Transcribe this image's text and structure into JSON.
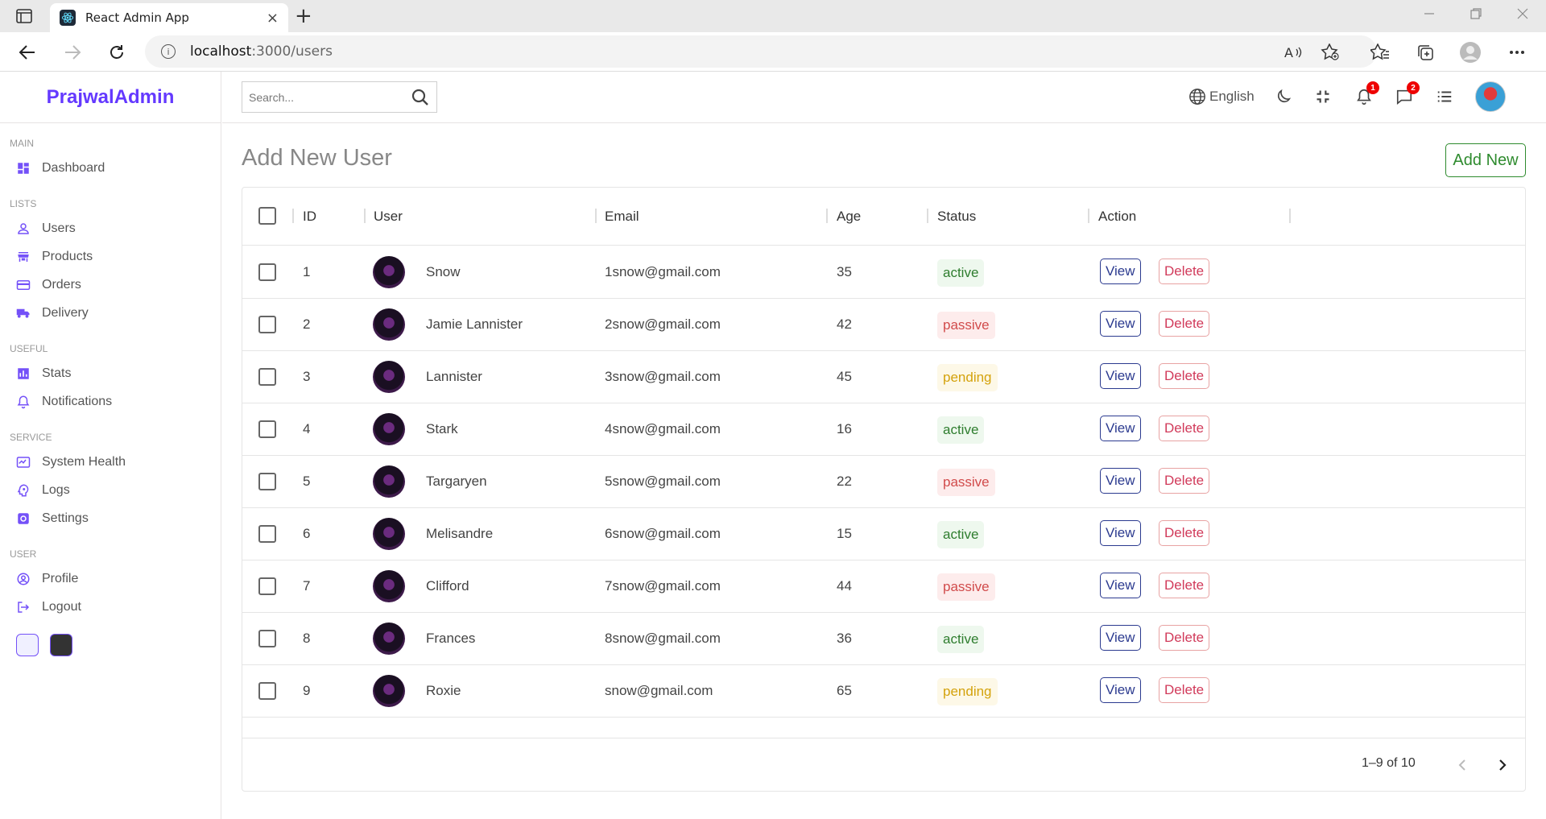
{
  "browser": {
    "tab_title": "React Admin App",
    "tab_close": "×",
    "new_tab": "+",
    "url_host": "localhost",
    "url_path": ":3000/users",
    "info_glyph": "i"
  },
  "sidebar": {
    "logo": "PrajwalAdmin",
    "sections": [
      {
        "title": "MAIN",
        "items": [
          {
            "label": "Dashboard",
            "icon": "dashboard-icon"
          }
        ]
      },
      {
        "title": "LISTS",
        "items": [
          {
            "label": "Users",
            "icon": "person-icon"
          },
          {
            "label": "Products",
            "icon": "store-icon"
          },
          {
            "label": "Orders",
            "icon": "credit-card-icon"
          },
          {
            "label": "Delivery",
            "icon": "truck-icon"
          }
        ]
      },
      {
        "title": "USEFUL",
        "items": [
          {
            "label": "Stats",
            "icon": "bar-chart-icon"
          },
          {
            "label": "Notifications",
            "icon": "bell-icon"
          }
        ]
      },
      {
        "title": "SERVICE",
        "items": [
          {
            "label": "System Health",
            "icon": "health-icon"
          },
          {
            "label": "Logs",
            "icon": "psychology-icon"
          },
          {
            "label": "Settings",
            "icon": "settings-icon"
          }
        ]
      },
      {
        "title": "USER",
        "items": [
          {
            "label": "Profile",
            "icon": "account-circle-icon"
          },
          {
            "label": "Logout",
            "icon": "logout-icon"
          }
        ]
      }
    ],
    "theme_colors": [
      "#f0f0ff",
      "#333333"
    ]
  },
  "navbar": {
    "search_placeholder": "Search...",
    "language": "English",
    "notifications_count": "1",
    "messages_count": "2"
  },
  "main": {
    "title": "Add New User",
    "add_new_label": "Add New",
    "columns": [
      "ID",
      "User",
      "Email",
      "Age",
      "Status",
      "Action"
    ],
    "rows": [
      {
        "id": "1",
        "user": "Snow",
        "email": "1snow@gmail.com",
        "age": "35",
        "status": "active"
      },
      {
        "id": "2",
        "user": "Jamie Lannister",
        "email": "2snow@gmail.com",
        "age": "42",
        "status": "passive"
      },
      {
        "id": "3",
        "user": "Lannister",
        "email": "3snow@gmail.com",
        "age": "45",
        "status": "pending"
      },
      {
        "id": "4",
        "user": "Stark",
        "email": "4snow@gmail.com",
        "age": "16",
        "status": "active"
      },
      {
        "id": "5",
        "user": "Targaryen",
        "email": "5snow@gmail.com",
        "age": "22",
        "status": "passive"
      },
      {
        "id": "6",
        "user": "Melisandre",
        "email": "6snow@gmail.com",
        "age": "15",
        "status": "active"
      },
      {
        "id": "7",
        "user": "Clifford",
        "email": "7snow@gmail.com",
        "age": "44",
        "status": "passive"
      },
      {
        "id": "8",
        "user": "Frances",
        "email": "8snow@gmail.com",
        "age": "36",
        "status": "active"
      },
      {
        "id": "9",
        "user": "Roxie",
        "email": "snow@gmail.com",
        "age": "65",
        "status": "pending"
      }
    ],
    "view_label": "View",
    "delete_label": "Delete",
    "pagination": "1–9 of 10"
  },
  "colors": {
    "accent": "#6439ff",
    "active": "#2e7d2e",
    "passive": "#d14b4b",
    "pending": "#d4a20c"
  }
}
